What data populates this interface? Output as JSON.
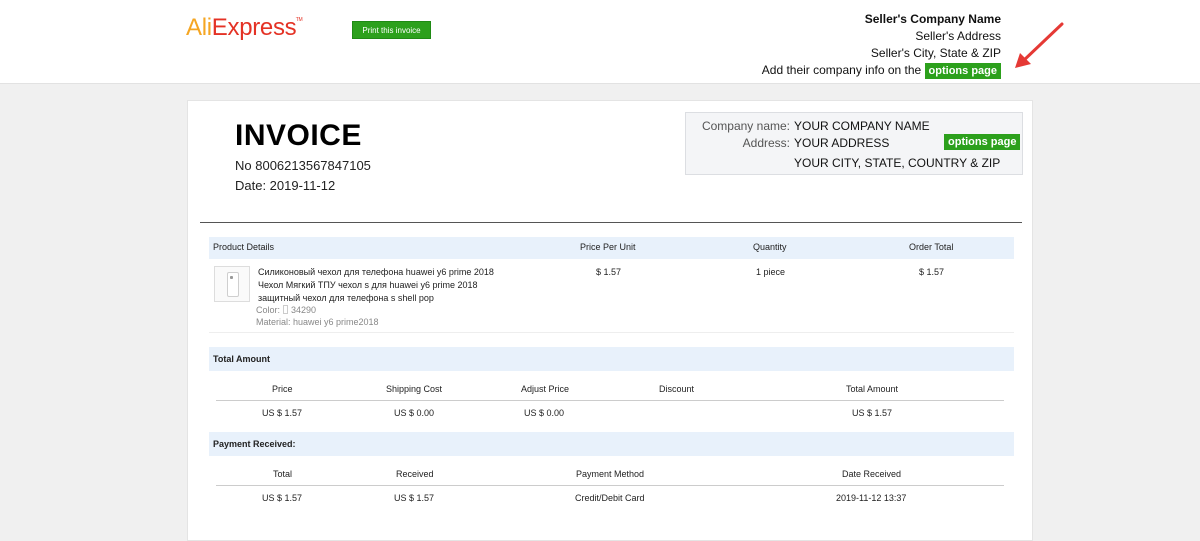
{
  "header": {
    "logo_ali": "Ali",
    "logo_express": "Express",
    "logo_tm": "TM",
    "print_button": "Print this invoice",
    "seller_name": "Seller's Company Name",
    "seller_address": "Seller's Address",
    "seller_city": "Seller's City, State & ZIP",
    "seller_note": "Add their company info on the",
    "options_link": "options page"
  },
  "invoice": {
    "title": "INVOICE",
    "number": "No 8006213567847105",
    "date": "Date: 2019-11-12"
  },
  "company_box": {
    "name_label": "Company name:",
    "name_value": "YOUR COMPANY NAME",
    "address_label": "Address:",
    "address_value": "YOUR ADDRESS",
    "city_value": "YOUR CITY, STATE, COUNTRY & ZIP",
    "options_button": "options page"
  },
  "products": {
    "headers": [
      "Product Details",
      "Price Per Unit",
      "Quantity",
      "Order Total"
    ],
    "rows": [
      {
        "name_lines": [
          "Силиконовый чехол для телефона huawei y6 prime 2018",
          "Чехол Мягкий ТПУ чехол s для huawei y6 prime 2018",
          "защитный чехол для телефона s shell pop"
        ],
        "color_label": "Color:",
        "color_value": "34290",
        "material": "Material: huawei y6 prime2018",
        "price": "$ 1.57",
        "quantity": "1 piece",
        "total": "$ 1.57"
      }
    ]
  },
  "total_amount": {
    "title": "Total Amount",
    "headers": [
      "Price",
      "Shipping Cost",
      "Adjust Price",
      "Discount",
      "Total Amount"
    ],
    "values": [
      "US $ 1.57",
      "US $ 0.00",
      "US $ 0.00",
      "",
      "US $ 1.57"
    ]
  },
  "payment": {
    "title": "Payment Received:",
    "headers": [
      "Total",
      "Received",
      "Payment Method",
      "Date Received"
    ],
    "values": [
      "US $ 1.57",
      "US $ 1.57",
      "Credit/Debit Card",
      "2019-11-12 13:37"
    ]
  },
  "colors": {
    "accent_green": "#2ca01c",
    "logo_orange": "#f5a623",
    "logo_red": "#e43225",
    "arrow_red": "#e53935",
    "section_blue": "#e8f1fb"
  }
}
